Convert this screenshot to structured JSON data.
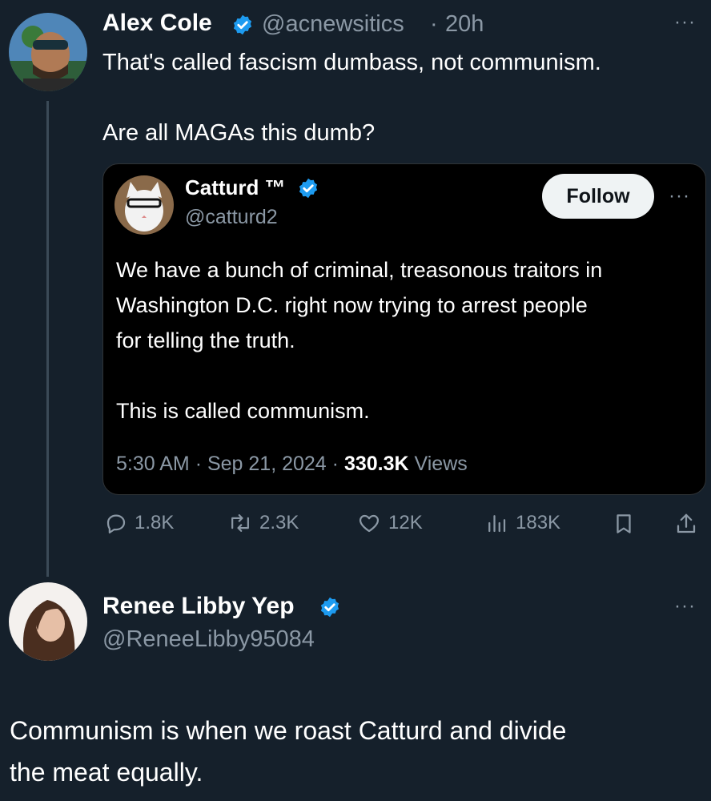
{
  "tweet": {
    "author_name": "Alex Cole",
    "handle": "@acnewsitics",
    "separator": "·",
    "time": "20h",
    "more": "···",
    "line1": "That's called fascism dumbass, not communism.",
    "line2": "Are all MAGAs this dumb?"
  },
  "quoted": {
    "author_name": "Catturd ™",
    "handle": "@catturd2",
    "follow_label": "Follow",
    "more": "···",
    "lines": [
      "We have a bunch of criminal, treasonous traitors in",
      "Washington D.C. right now trying to arrest people",
      "for telling the truth.",
      "This is called communism."
    ],
    "time": "5:30 AM",
    "date": "Sep 21, 2024",
    "views_count": "330.3K",
    "views_label": "Views",
    "separator": "·"
  },
  "actions": {
    "replies": "1.8K",
    "reposts": "2.3K",
    "likes": "12K",
    "views": "183K"
  },
  "reply": {
    "author_name": "Renee Libby Yep",
    "handle": "@ReneeLibby95084",
    "more": "···",
    "line1": "Communism is when we roast Catturd and divide",
    "line2": "the meat equally."
  },
  "colors": {
    "background": "#15202b",
    "verified": "#1d9bf0",
    "muted": "#8b98a5"
  },
  "icons": [
    "verified-badge-icon",
    "reply-icon",
    "repost-icon",
    "like-icon",
    "views-icon",
    "bookmark-icon",
    "share-icon",
    "more-icon"
  ]
}
